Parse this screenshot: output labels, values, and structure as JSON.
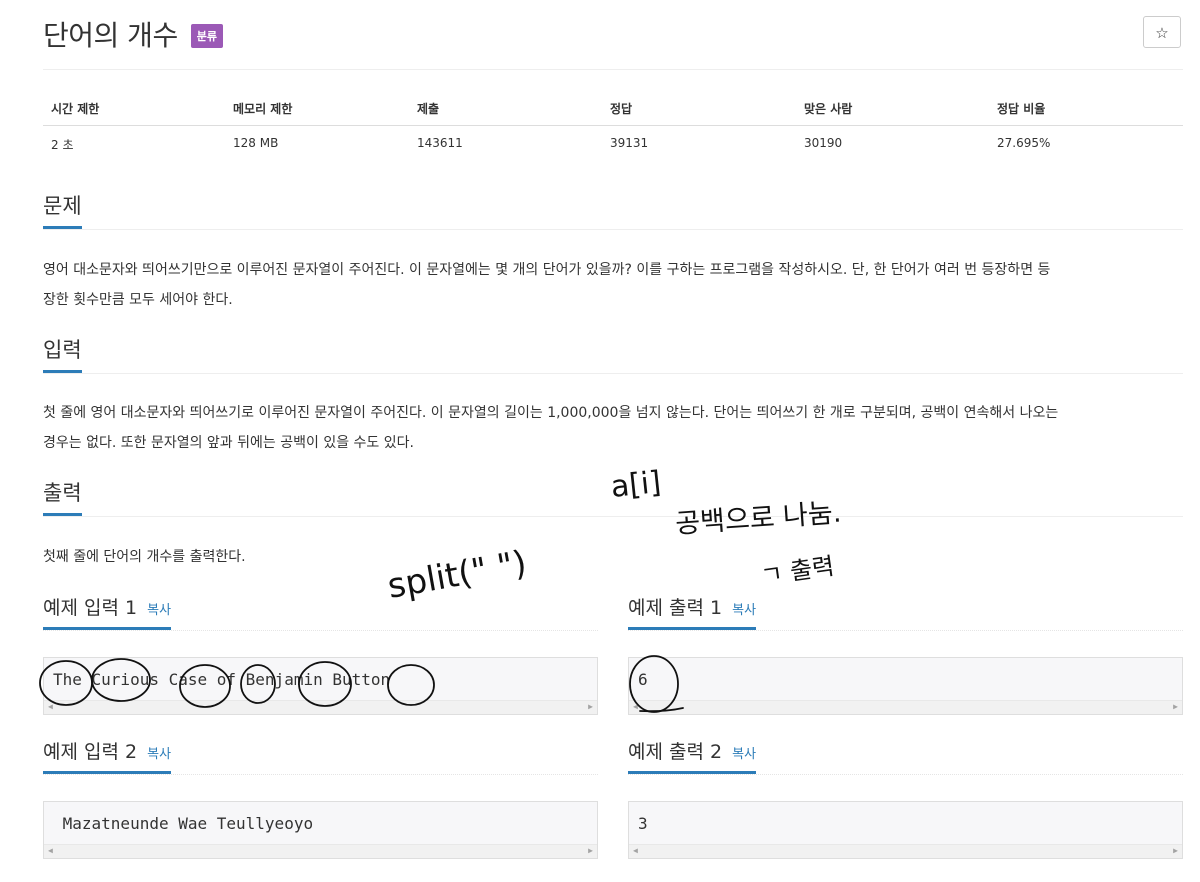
{
  "problem": {
    "title": "단어의 개수",
    "category_badge": "분류",
    "star_icon": "☆"
  },
  "info_table": {
    "headers": [
      "시간 제한",
      "메모리 제한",
      "제출",
      "정답",
      "맞은 사람",
      "정답 비율"
    ],
    "values": [
      "2 초",
      "128 MB",
      "143611",
      "39131",
      "30190",
      "27.695%"
    ]
  },
  "sections": {
    "problem_title": "문제",
    "problem_text_1": "영어 대소문자와 띄어쓰기만으로 이루어진 문자열이 주어진다. 이 문자열에는 몇 개의 단어가 있을까? 이를 구하는 프로그램을 작성하시오. 단, 한 단어가 여러 번 등장하면 등",
    "problem_text_2": "장한 횟수만큼 모두 세어야 한다.",
    "input_title": "입력",
    "input_text_1": "첫 줄에 영어 대소문자와 띄어쓰기로 이루어진 문자열이 주어진다. 이 문자열의 길이는 1,000,000을 넘지 않는다. 단어는 띄어쓰기 한 개로 구분되며, 공백이 연속해서 나오는",
    "input_text_2": "경우는 없다. 또한 문자열의 앞과 뒤에는 공백이 있을 수도 있다.",
    "output_title": "출력",
    "output_text": "첫째 줄에 단어의 개수를 출력한다."
  },
  "samples": {
    "copy_label": "복사",
    "input1_title": "예제 입력 1",
    "input1_value": "The Curious Case of Benjamin Button",
    "output1_title": "예제 출력 1",
    "output1_value": "6",
    "input2_title": "예제 입력 2",
    "input2_value": " Mazatneunde Wae Teullyeoyo",
    "output2_title": "예제 출력 2",
    "output2_value": "3"
  },
  "scroll_arrows": {
    "left": "◀",
    "right": "▶"
  },
  "handwriting": {
    "split_note": "split(\" \")",
    "array_note": "a[i]",
    "split_space_note": "공백으로 나눔.",
    "print_note": "ㄱ 출력"
  }
}
